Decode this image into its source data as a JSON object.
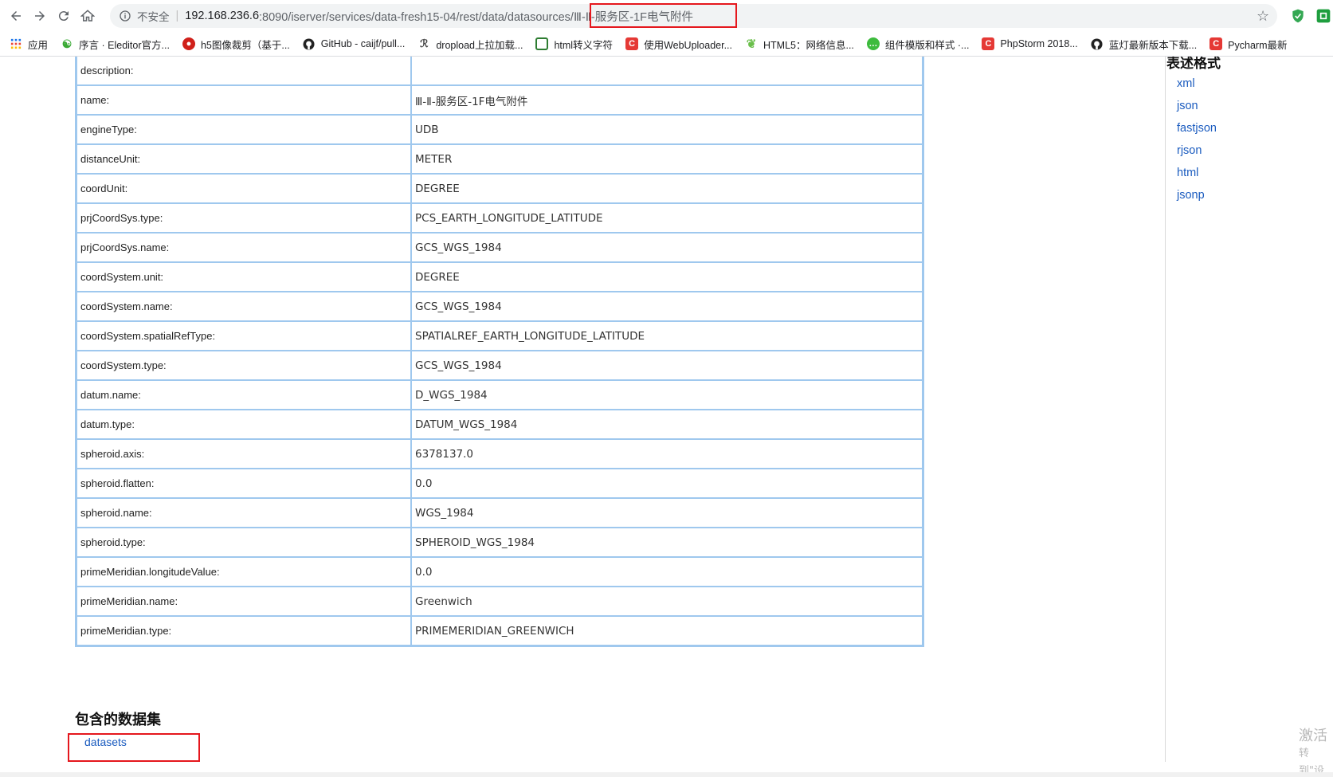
{
  "toolbar": {
    "insecure_label": "不安全",
    "url_host": "192.168.236.6",
    "url_path": ":8090/iserver/services/data-fresh15-04/rest/data/datasources/Ⅲ-Ⅱ-服务区-1F电气附件"
  },
  "bookmarks": [
    {
      "label": "应用",
      "icon": "apps-grid-icon"
    },
    {
      "label": "序言 · Eleditor官方...",
      "icon": "eleditor-icon"
    },
    {
      "label": "h5图像裁剪（基于...",
      "icon": "red-circle-icon"
    },
    {
      "label": "GitHub - caijf/pull...",
      "icon": "github-icon"
    },
    {
      "label": "dropload上拉加载...",
      "icon": "dropload-icon"
    },
    {
      "label": "html转义字符",
      "icon": "box-icon"
    },
    {
      "label": "使用WebUploader...",
      "icon": "csdn-icon"
    },
    {
      "label": "HTML5：网络信息...",
      "icon": "leaf-icon"
    },
    {
      "label": "组件模版和样式 ·...",
      "icon": "wechat-icon"
    },
    {
      "label": "PhpStorm 2018...",
      "icon": "csdn-icon"
    },
    {
      "label": "蓝灯最新版本下载...",
      "icon": "github-icon"
    },
    {
      "label": "Pycharm最新",
      "icon": "csdn-icon"
    }
  ],
  "attributes": [
    {
      "key": "description:",
      "value": ""
    },
    {
      "key": "name:",
      "value": "Ⅲ-Ⅱ-服务区-1F电气附件"
    },
    {
      "key": "engineType:",
      "value": "UDB"
    },
    {
      "key": "distanceUnit:",
      "value": "METER"
    },
    {
      "key": "coordUnit:",
      "value": "DEGREE"
    },
    {
      "key": "prjCoordSys.type:",
      "value": "PCS_EARTH_LONGITUDE_LATITUDE"
    },
    {
      "key": "prjCoordSys.name:",
      "value": "GCS_WGS_1984"
    },
    {
      "key": "coordSystem.unit:",
      "value": "DEGREE"
    },
    {
      "key": "coordSystem.name:",
      "value": "GCS_WGS_1984"
    },
    {
      "key": "coordSystem.spatialRefType:",
      "value": "SPATIALREF_EARTH_LONGITUDE_LATITUDE"
    },
    {
      "key": "coordSystem.type:",
      "value": "GCS_WGS_1984"
    },
    {
      "key": "datum.name:",
      "value": "D_WGS_1984"
    },
    {
      "key": "datum.type:",
      "value": "DATUM_WGS_1984"
    },
    {
      "key": "spheroid.axis:",
      "value": "6378137.0"
    },
    {
      "key": "spheroid.flatten:",
      "value": "0.0"
    },
    {
      "key": "spheroid.name:",
      "value": "WGS_1984"
    },
    {
      "key": "spheroid.type:",
      "value": "SPHEROID_WGS_1984"
    },
    {
      "key": "primeMeridian.longitudeValue:",
      "value": "0.0"
    },
    {
      "key": "primeMeridian.name:",
      "value": "Greenwich"
    },
    {
      "key": "primeMeridian.type:",
      "value": "PRIMEMERIDIAN_GREENWICH"
    }
  ],
  "datasets_section": {
    "title": "包含的数据集",
    "link": "datasets"
  },
  "formats": {
    "title": "表述格式",
    "items": [
      "xml",
      "json",
      "fastjson",
      "rjson",
      "html",
      "jsonp"
    ]
  },
  "watermark": {
    "line1": "激活",
    "line2": "转到\"设"
  },
  "colors": {
    "table_border": "#9fc8ee",
    "link": "#1a5bbf",
    "highlight": "#e5171d"
  }
}
